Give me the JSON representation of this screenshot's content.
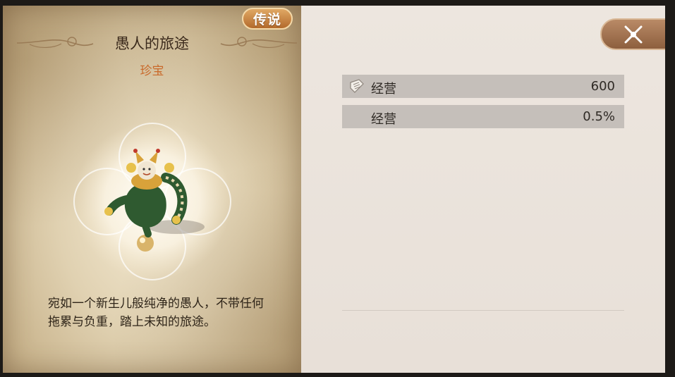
{
  "item": {
    "rarity": "传说",
    "name": "愚人的旅途",
    "category": "珍宝",
    "description": "宛如一个新生儿般纯净的愚人，不带任何拖累与负重，踏上未知的旅途。"
  },
  "stats": [
    {
      "icon": "scroll-icon",
      "name": "经营",
      "value": "600"
    },
    {
      "icon": "",
      "name": "经营",
      "value": "0.5%"
    }
  ],
  "close_icon": "close-icon"
}
